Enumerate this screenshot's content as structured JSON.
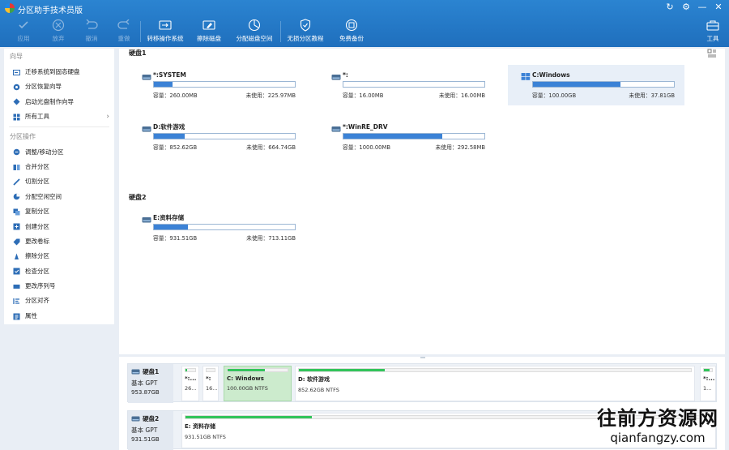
{
  "app": {
    "title": "分区助手技术员版"
  },
  "toolbar": {
    "apply": "应用",
    "discard": "放弃",
    "undo": "撤消",
    "redo": "重做",
    "migrate_os": "转移操作系统",
    "wipe_disk": "擦除磁盘",
    "allocate_space": "分配磁盘空间",
    "lossless_tutorial": "无损分区教程",
    "free_backup": "免费备份",
    "tools": "工具"
  },
  "sidebar": {
    "wizard_title": "向导",
    "wizard_items": [
      {
        "label": "迁移系统到固态硬盘",
        "icon": "migrate-icon"
      },
      {
        "label": "分区恢复向导",
        "icon": "recover-icon"
      },
      {
        "label": "启动光盘制作向导",
        "icon": "bootdisc-icon"
      },
      {
        "label": "所有工具",
        "icon": "tools-icon"
      }
    ],
    "ops_title": "分区操作",
    "ops_items": [
      {
        "label": "调整/移动分区",
        "icon": "resize-icon"
      },
      {
        "label": "合并分区",
        "icon": "merge-icon"
      },
      {
        "label": "切割分区",
        "icon": "split-icon"
      },
      {
        "label": "分配空闲空间",
        "icon": "allocate-icon"
      },
      {
        "label": "复制分区",
        "icon": "copy-icon"
      },
      {
        "label": "创建分区",
        "icon": "create-icon"
      },
      {
        "label": "更改卷标",
        "icon": "label-icon"
      },
      {
        "label": "擦除分区",
        "icon": "wipe-icon"
      },
      {
        "label": "检查分区",
        "icon": "check-icon"
      },
      {
        "label": "更改序列号",
        "icon": "serial-icon"
      },
      {
        "label": "分区对齐",
        "icon": "align-icon"
      },
      {
        "label": "属性",
        "icon": "properties-icon"
      }
    ]
  },
  "main": {
    "disk1_label": "硬盘1",
    "disk2_label": "硬盘2",
    "cap_prefix": "容量：",
    "free_prefix": "未使用：",
    "disk1_partitions": [
      {
        "name": "*:SYSTEM",
        "capacity": "260.00MB",
        "free": "225.97MB",
        "used_pct": 13,
        "icon": "drive-icon"
      },
      {
        "name": "*:",
        "capacity": "16.00MB",
        "free": "16.00MB",
        "used_pct": 0,
        "icon": "drive-icon"
      },
      {
        "name": "C:Windows",
        "capacity": "100.00GB",
        "free": "37.81GB",
        "used_pct": 62,
        "icon": "windows-icon",
        "selected": true
      },
      {
        "name": "D:软件游戏",
        "capacity": "852.62GB",
        "free": "664.74GB",
        "used_pct": 22,
        "icon": "drive-icon"
      },
      {
        "name": "*:WinRE_DRV",
        "capacity": "1000.00MB",
        "free": "292.58MB",
        "used_pct": 70,
        "icon": "drive-icon"
      }
    ],
    "disk2_partitions": [
      {
        "name": "E:资料存储",
        "capacity": "931.51GB",
        "free": "713.11GB",
        "used_pct": 24,
        "icon": "drive-icon"
      }
    ]
  },
  "bottom": {
    "disk1": {
      "name": "硬盘1",
      "type": "基本 GPT",
      "size": "953.87GB"
    },
    "disk2": {
      "name": "硬盘2",
      "type": "基本 GPT",
      "size": "931.51GB"
    },
    "disk1_segments": [
      {
        "name": "*:...",
        "detail": "26...",
        "fill_pct": 13
      },
      {
        "name": "*:",
        "detail": "16...",
        "fill_pct": 0
      },
      {
        "name": "C: Windows",
        "detail": "100.00GB NTFS",
        "fill_pct": 62,
        "selected": true
      },
      {
        "name": "D: 软件游戏",
        "detail": "852.62GB NTFS",
        "fill_pct": 22
      },
      {
        "name": "*:...",
        "detail": "1...",
        "fill_pct": 70
      }
    ],
    "disk2_segments": [
      {
        "name": "E: 资料存储",
        "detail": "931.51GB NTFS",
        "fill_pct": 24
      }
    ]
  },
  "watermark": {
    "main": "往前方资源网",
    "sub": "qianfangzy.com"
  }
}
